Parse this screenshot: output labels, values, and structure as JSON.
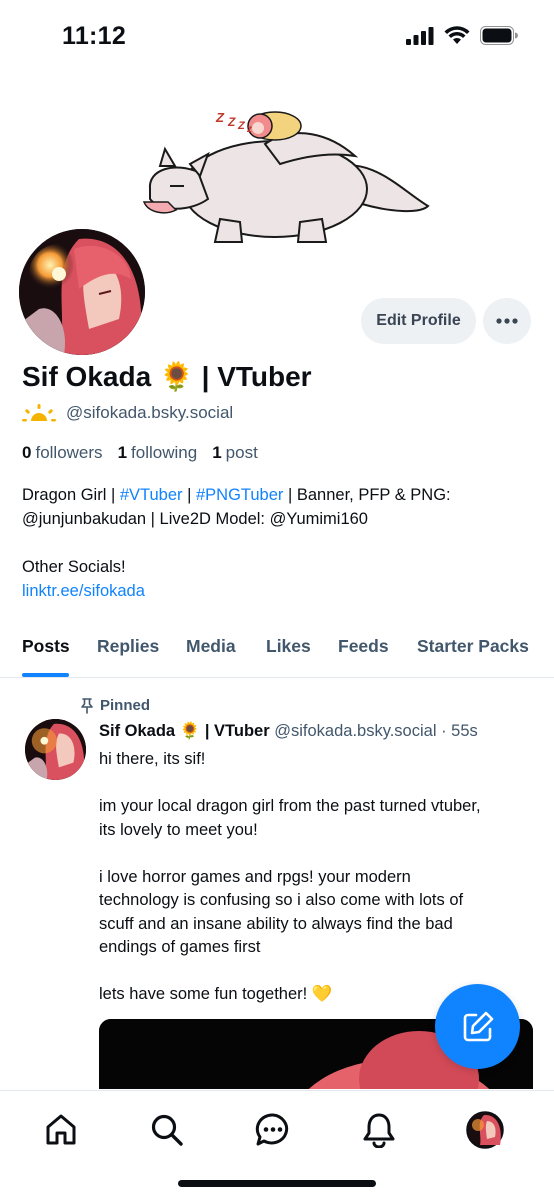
{
  "status_bar": {
    "time": "11:12"
  },
  "profile": {
    "display_name": "Sif Okada 🌻 | VTuber",
    "handle": "@sifokada.bsky.social",
    "edit_label": "Edit Profile",
    "stats": {
      "followers_count": "0",
      "followers_label": "followers",
      "following_count": "1",
      "following_label": "following",
      "posts_count": "1",
      "posts_label": "post"
    },
    "bio": {
      "l1_a": "Dragon Girl | ",
      "l1_b": "#VTuber",
      "l1_c": " | ",
      "l1_d": "#PNGTuber",
      "l1_e": " | Banner, PFP & PNG:",
      "l2": "@junjunbakudan | Live2D Model: @Yumimi160",
      "l3": "Other Socials!",
      "l4": "linktr.ee/sifokada"
    }
  },
  "tabs": [
    "Posts",
    "Replies",
    "Media",
    "Likes",
    "Feeds",
    "Starter Packs"
  ],
  "post": {
    "pinned_label": "Pinned",
    "author_name": "Sif Okada 🌻 | VTuber",
    "author_handle": "@sifokada.bsky.social",
    "time": "· 55s",
    "lines": {
      "l1": "hi there, its sif!",
      "l2": "im your local dragon girl from the past turned vtuber,",
      "l3": "its lovely to meet you!",
      "l4": "i love horror games and rpgs! your modern",
      "l5": "technology is confusing so i also come with lots of",
      "l6": "scuff and an insane ability to always find the bad",
      "l7": "endings of games first",
      "l8": "lets have some fun together! 💛"
    }
  },
  "colors": {
    "accent": "#1083fe",
    "muted": "#42576c",
    "button_bg": "#eef1f4"
  },
  "icons": {
    "home": "home-icon",
    "search": "search-icon",
    "chat": "chat-icon",
    "notifications": "bell-icon",
    "compose": "compose-icon"
  }
}
